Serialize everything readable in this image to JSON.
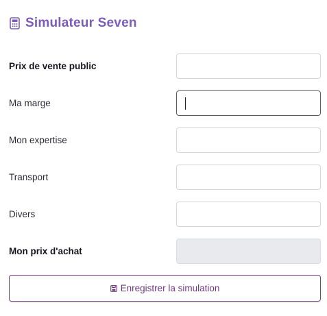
{
  "header": {
    "icon": "calculator-icon",
    "title": "Simulateur Seven",
    "accent_color": "#7b5cb8"
  },
  "form": {
    "fields": [
      {
        "label": "Prix de vente public",
        "value": "",
        "bold": true
      },
      {
        "label": "Ma marge",
        "value": "",
        "bold": false,
        "focused": true
      },
      {
        "label": "Mon expertise",
        "value": "",
        "bold": false
      },
      {
        "label": "Transport",
        "value": "",
        "bold": false
      },
      {
        "label": "Divers",
        "value": "",
        "bold": false
      },
      {
        "label": "Mon prix d'achat",
        "value": "",
        "bold": true,
        "readonly": true
      }
    ]
  },
  "actions": {
    "save_icon": "save-icon",
    "save_label": "Enregistrer la simulation",
    "save_color": "#6e3a7c"
  }
}
